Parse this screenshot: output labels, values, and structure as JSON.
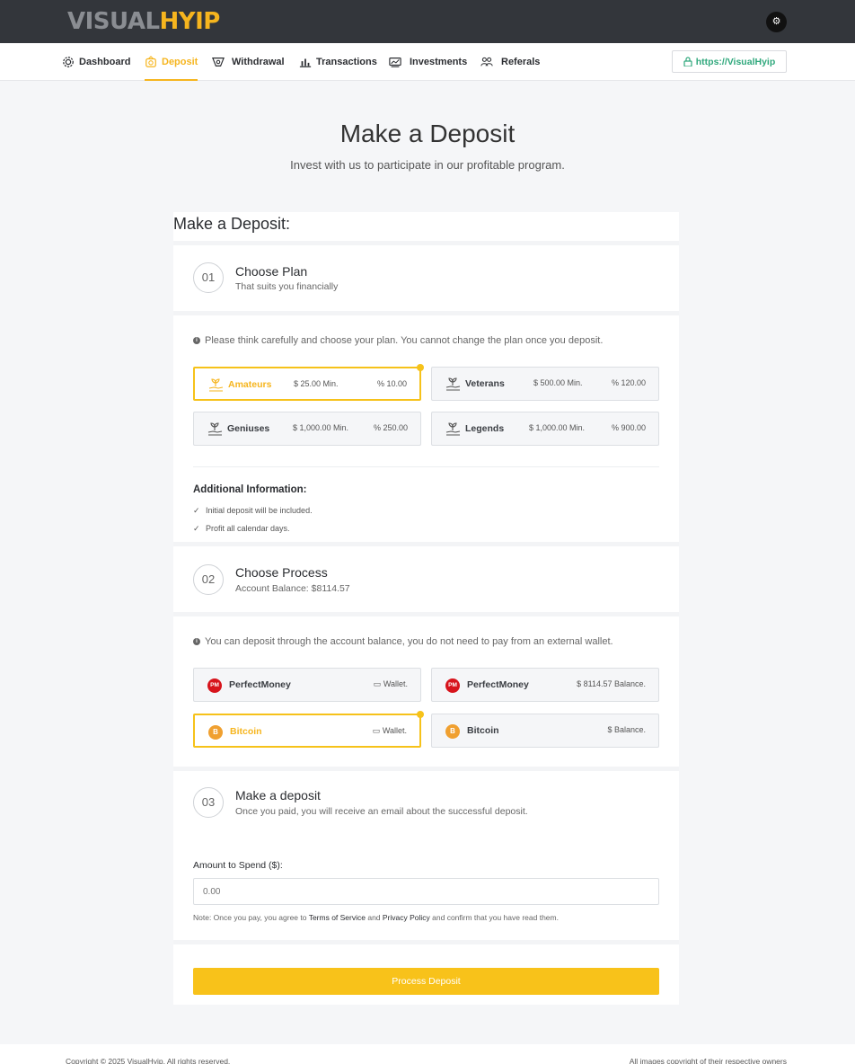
{
  "brand": {
    "part1": "VISUAL",
    "part2": "HYIP"
  },
  "colors": {
    "accent": "#f6b51e",
    "topbar": "#33363b",
    "success": "#2fa87c"
  },
  "nav": {
    "items": [
      {
        "label": "Dashboard",
        "icon": "gear-icon"
      },
      {
        "label": "Deposit",
        "icon": "deposit-icon",
        "active": true
      },
      {
        "label": "Withdrawal",
        "icon": "withdrawal-icon"
      },
      {
        "label": "Transactions",
        "icon": "chart-icon"
      },
      {
        "label": "Investments",
        "icon": "investments-icon"
      },
      {
        "label": "Referals",
        "icon": "users-icon"
      }
    ],
    "url": "https://VisualHyip"
  },
  "hero": {
    "title": "Make a Deposit",
    "subtitle": "Invest with us to participate in our profitable program."
  },
  "form": {
    "title": "Make a Deposit:",
    "step1": {
      "num": "01",
      "title": "Choose Plan",
      "subtitle": "That suits you financially",
      "info": "Please think carefully and choose your plan. You cannot change the plan once you deposit.",
      "plans": [
        {
          "name": "Amateurs",
          "min": "$ 25.00 Min.",
          "pct": "% 10.00",
          "selected": true
        },
        {
          "name": "Veterans",
          "min": "$ 500.00 Min.",
          "pct": "% 120.00",
          "selected": false
        },
        {
          "name": "Geniuses",
          "min": "$ 1,000.00 Min.",
          "pct": "% 250.00",
          "selected": false
        },
        {
          "name": "Legends",
          "min": "$ 1,000.00 Min.",
          "pct": "% 900.00",
          "selected": false
        }
      ],
      "additional_title": "Additional Information:",
      "additional_items": [
        "Initial deposit will be included.",
        "Profit all calendar days."
      ]
    },
    "step2": {
      "num": "02",
      "title": "Choose Process",
      "subtitle": "Account Balance: $8114.57",
      "info": "You can deposit through the account balance, you do not need to pay from an external wallet.",
      "methods": [
        {
          "name": "PerfectMoney",
          "logo": "PM",
          "right": "Wallet.",
          "selected": false
        },
        {
          "name": "PerfectMoney",
          "logo": "PM",
          "right": "$ 8114.57 Balance.",
          "selected": false
        },
        {
          "name": "Bitcoin",
          "logo": "B",
          "right": "Wallet.",
          "selected": true
        },
        {
          "name": "Bitcoin",
          "logo": "B",
          "right": "$ Balance.",
          "selected": false
        }
      ]
    },
    "step3": {
      "num": "03",
      "title": "Make a deposit",
      "subtitle": "Once you paid, you will receive an email about the successful deposit.",
      "amount_label": "Amount to Spend ($):",
      "amount_placeholder": "0.00",
      "note_pre": "Note: Once you pay, you agree to ",
      "terms": "Terms of Service",
      "and": " and ",
      "privacy": "Privacy Policy",
      "note_post": " and confirm that you have read them."
    },
    "submit_label": "Process Deposit"
  },
  "footer": {
    "left": "Copyright © 2025 VisualHyip. All rights reserved.",
    "right": "All images copyright of their respective owners"
  }
}
